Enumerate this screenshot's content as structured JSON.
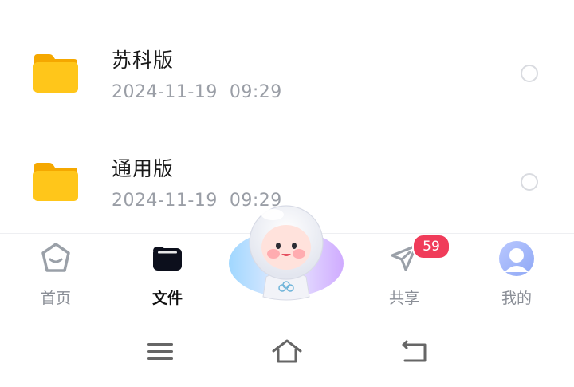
{
  "files": [
    {
      "name": "苏科版",
      "date": "2024-11-19  09:29"
    },
    {
      "name": "通用版",
      "date": "2024-11-19  09:29"
    }
  ],
  "tabs": [
    {
      "label": "首页",
      "icon": "home-icon"
    },
    {
      "label": "文件",
      "icon": "folder-icon",
      "active": true
    },
    {
      "label": "",
      "icon": "astronaut-mascot"
    },
    {
      "label": "共享",
      "icon": "send-icon",
      "badge": "59"
    },
    {
      "label": "我的",
      "icon": "avatar-icon"
    }
  ],
  "system_nav": [
    "menu-icon",
    "home-icon",
    "back-icon"
  ],
  "colors": {
    "folder": "#ffc61a",
    "badge": "#f03c5a",
    "active_text": "#111111",
    "inactive_text": "#8a8e96"
  }
}
